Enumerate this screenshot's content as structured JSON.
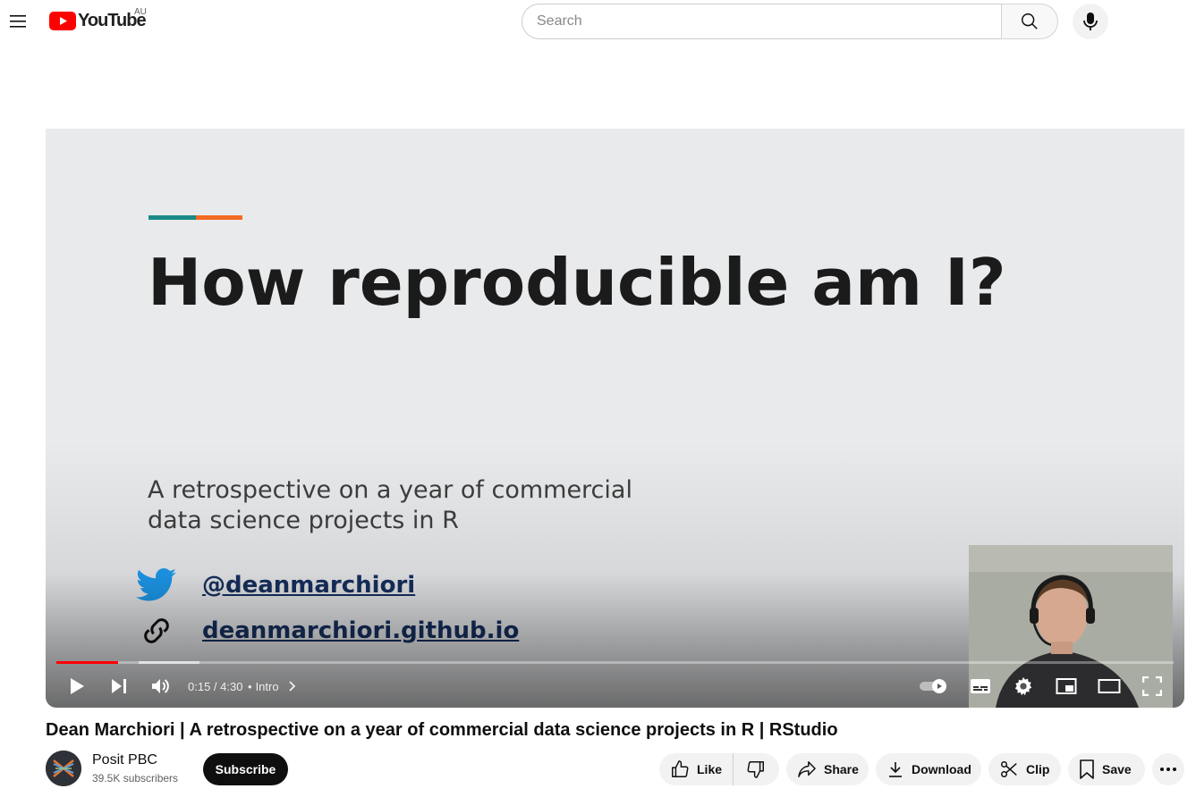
{
  "masthead": {
    "logo_text": "YouTube",
    "country_code": "AU",
    "search_placeholder": "Search"
  },
  "player": {
    "slide": {
      "title": "How reproducible am I?",
      "subtitle_line1": "A retrospective on a year of commercial",
      "subtitle_line2": "data science projects in R",
      "twitter_handle": "@deanmarchiori",
      "website": "deanmarchiori.github.io",
      "accent_colors": [
        "#1a8a86",
        "#f26b21"
      ]
    },
    "time_display": "0:15 / 4:30",
    "chapter_separator": "•",
    "chapter": "Intro",
    "progress_fraction": 0.0556,
    "played_color": "#ff0000"
  },
  "video": {
    "title": "Dean Marchiori | A retrospective on a year of commercial data science projects in R | RStudio"
  },
  "channel": {
    "name": "Posit PBC",
    "subscribers": "39.5K subscribers",
    "subscribe_label": "Subscribe"
  },
  "actions": {
    "like_label": "Like",
    "share_label": "Share",
    "download_label": "Download",
    "clip_label": "Clip",
    "save_label": "Save"
  }
}
